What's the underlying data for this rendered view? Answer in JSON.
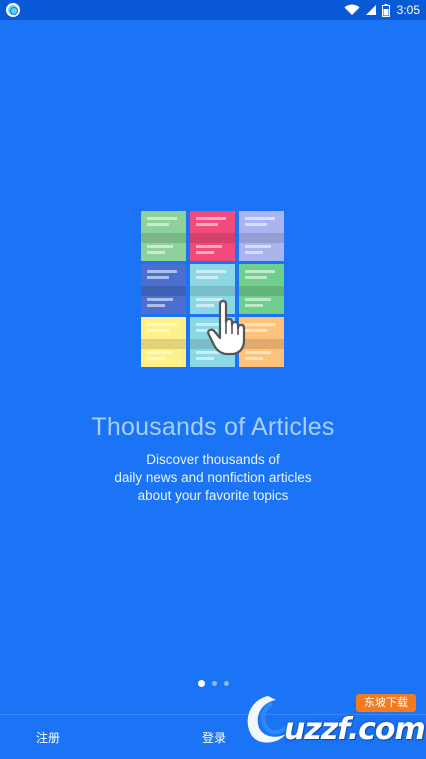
{
  "status_bar": {
    "time": "3:05",
    "icons": [
      "app-notification-icon",
      "wifi-icon",
      "signal-icon",
      "battery-icon"
    ]
  },
  "onboarding": {
    "title": "Thousands of Articles",
    "subtitle_lines": [
      "Discover thousands of",
      "daily news and nonfiction articles",
      "about your favorite topics"
    ],
    "illustration_colors": [
      "#8fd19b",
      "#f24a7a",
      "#a9b4f0",
      "#4a6fd1",
      "#8cd7e6",
      "#6fcf8c",
      "#fff08a",
      "#8cd7e6",
      "#ffc27a"
    ],
    "hand_icon": "pointing-hand-icon"
  },
  "pager": {
    "total": 3,
    "active_index": 0
  },
  "bottom_bar": {
    "register_label": "注册",
    "login_label": "登录"
  },
  "watermark": {
    "text": "uzzf.com",
    "badge": "东坡下载"
  },
  "colors": {
    "background": "#1b74f5",
    "status_bar": "#0a5ad8",
    "title": "#a8d0ff"
  }
}
